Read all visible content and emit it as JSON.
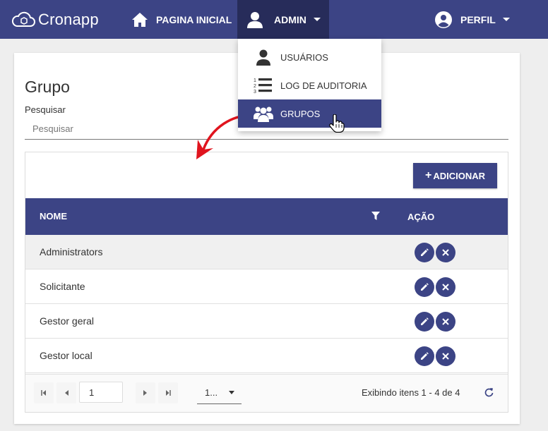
{
  "navbar": {
    "brand": "Cronapp",
    "home_label": "PAGINA INICIAL",
    "admin_label": "ADMIN",
    "profile_label": "PERFIL"
  },
  "admin_menu": {
    "items": [
      {
        "label": "USUÁRIOS",
        "icon": "user-icon"
      },
      {
        "label": "LOG DE AUDITORIA",
        "icon": "numbered-list-icon"
      },
      {
        "label": "GRUPOS",
        "icon": "users-group-icon",
        "active": true
      }
    ]
  },
  "page": {
    "title": "Grupo",
    "search_label": "Pesquisar",
    "search_placeholder": "Pesquisar"
  },
  "grid": {
    "add_label": "ADICIONAR",
    "columns": {
      "name": "NOME",
      "action": "AÇÃO"
    },
    "rows": [
      {
        "name": "Administrators"
      },
      {
        "name": "Solicitante"
      },
      {
        "name": "Gestor geral"
      },
      {
        "name": "Gestor local"
      }
    ],
    "pager": {
      "current_page": "1",
      "page_size": "1...",
      "info": "Exibindo itens 1 - 4 de 4"
    }
  },
  "colors": {
    "primary": "#3c4485",
    "primary_dark": "#272c5a",
    "annotation_arrow": "#e0141e"
  }
}
